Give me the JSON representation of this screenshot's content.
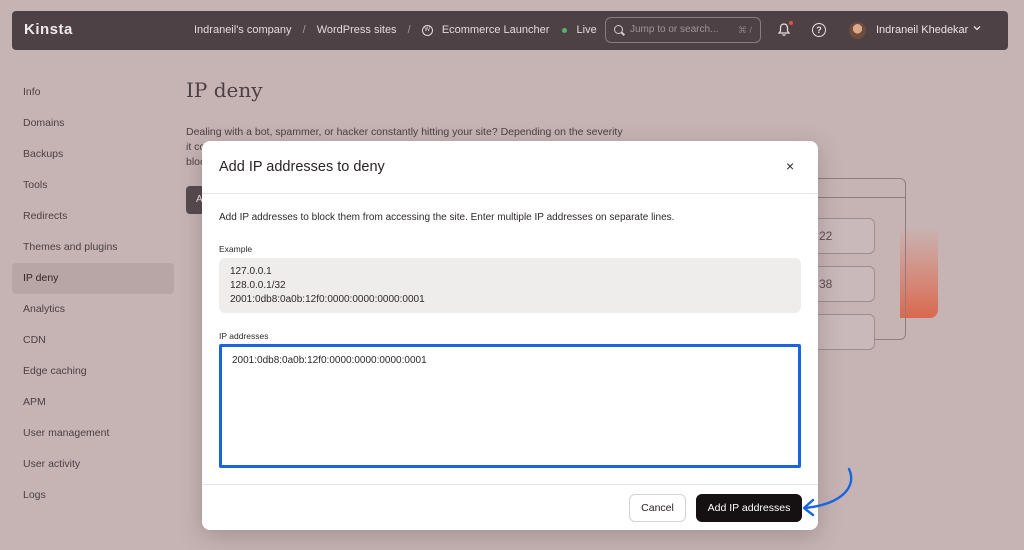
{
  "app": {
    "logo": "Kinsta"
  },
  "breadcrumb": {
    "company": "Indraneil's company",
    "section": "WordPress sites",
    "site": "Ecommerce Launcher",
    "status": "Live"
  },
  "search": {
    "placeholder": "Jump to or search...",
    "shortcut": "⌘ /"
  },
  "user": {
    "name": "Indraneil Khedekar"
  },
  "sidebar": {
    "items": [
      {
        "label": "Info"
      },
      {
        "label": "Domains"
      },
      {
        "label": "Backups"
      },
      {
        "label": "Tools"
      },
      {
        "label": "Redirects"
      },
      {
        "label": "Themes and plugins"
      },
      {
        "label": "IP deny",
        "active": true
      },
      {
        "label": "Analytics"
      },
      {
        "label": "CDN"
      },
      {
        "label": "Edge caching"
      },
      {
        "label": "APM"
      },
      {
        "label": "User management"
      },
      {
        "label": "User activity"
      },
      {
        "label": "Logs"
      }
    ]
  },
  "page": {
    "title": "IP deny",
    "description_line1": "Dealing with a bot, spammer, or hacker constantly hitting your site? Depending on the severity",
    "description_line2": "it co",
    "description_line3": "bloc",
    "button_fragment": "A"
  },
  "illustration": {
    "card1": "22",
    "card2": "38"
  },
  "modal": {
    "title": "Add IP addresses to deny",
    "close_symbol": "×",
    "help_text": "Add IP addresses to block them from accessing the site. Enter multiple IP addresses on separate lines.",
    "example_label": "Example",
    "example_lines": [
      "127.0.0.1",
      "128.0.0.1/32",
      "2001:0db8:0a0b:12f0:0000:0000:0000:0001"
    ],
    "ip_label": "IP addresses",
    "ip_value": "2001:0db8:0a0b:12f0:0000:0000:0000:0001",
    "cancel_label": "Cancel",
    "submit_label": "Add IP addresses"
  },
  "colors": {
    "highlight": "#1766e0",
    "topbar": "#4d4145",
    "primary_button": "#151012"
  }
}
